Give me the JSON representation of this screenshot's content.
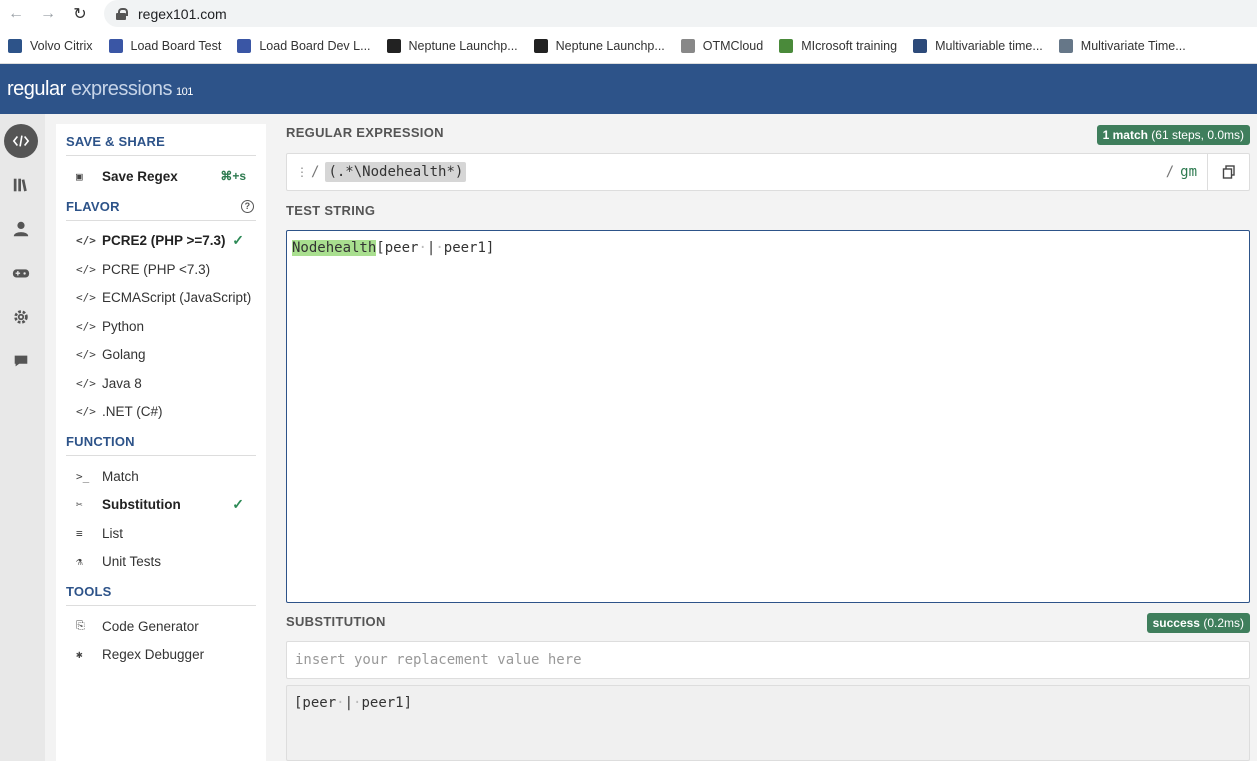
{
  "browser": {
    "url": "regex101.com",
    "bookmarks": [
      {
        "label": "Volvo Citrix",
        "color": "#2d5389"
      },
      {
        "label": "Load Board Test",
        "color": "#3a56a5"
      },
      {
        "label": "Load Board Dev L...",
        "color": "#3a56a5"
      },
      {
        "label": "Neptune Launchp...",
        "color": "#222222"
      },
      {
        "label": "Neptune Launchp...",
        "color": "#222222"
      },
      {
        "label": "OTMCloud",
        "color": "#888888"
      },
      {
        "label": "MIcrosoft training",
        "color": "#4a8a3a"
      },
      {
        "label": "Multivariable time...",
        "color": "#2d4a7a"
      },
      {
        "label": "Multivariate Time...",
        "color": "#667788"
      }
    ]
  },
  "header": {
    "logo_main": "regular",
    "logo_light": "expressions",
    "logo_num": "101"
  },
  "sidebar": {
    "save_title": "SAVE & SHARE",
    "save_label": "Save Regex",
    "save_shortcut": "⌘+s",
    "flavor_title": "FLAVOR",
    "flavors": [
      {
        "label": "PCRE2 (PHP >=7.3)",
        "selected": true
      },
      {
        "label": "PCRE (PHP <7.3)",
        "selected": false
      },
      {
        "label": "ECMAScript (JavaScript)",
        "selected": false
      },
      {
        "label": "Python",
        "selected": false
      },
      {
        "label": "Golang",
        "selected": false
      },
      {
        "label": "Java 8",
        "selected": false
      },
      {
        "label": ".NET (C#)",
        "selected": false
      }
    ],
    "function_title": "FUNCTION",
    "functions": [
      {
        "label": "Match",
        "icon": ">_",
        "selected": false
      },
      {
        "label": "Substitution",
        "icon": "✂",
        "selected": true
      },
      {
        "label": "List",
        "icon": "≡",
        "selected": false
      },
      {
        "label": "Unit Tests",
        "icon": "⚗",
        "selected": false
      }
    ],
    "tools_title": "TOOLS",
    "tools": [
      {
        "label": "Code Generator",
        "icon": "⎘"
      },
      {
        "label": "Regex Debugger",
        "icon": "✱"
      }
    ]
  },
  "regex": {
    "label": "REGULAR EXPRESSION",
    "match_count": "1 match",
    "match_detail": "(61 steps, 0.0ms)",
    "delimiter": "/",
    "expression": "(.*\\Nodehealth*)",
    "flags": "gm"
  },
  "test": {
    "label": "TEST STRING",
    "match_text": "Nodehealth",
    "rest_a": "[peer",
    "ws_dot": "·",
    "pipe": "|",
    "rest_b": "peer1]"
  },
  "substitution": {
    "label": "SUBSTITUTION",
    "status": "success",
    "status_detail": "(0.2ms)",
    "placeholder": "insert your replacement value here",
    "out_a": "[peer",
    "out_b": "peer1]"
  }
}
